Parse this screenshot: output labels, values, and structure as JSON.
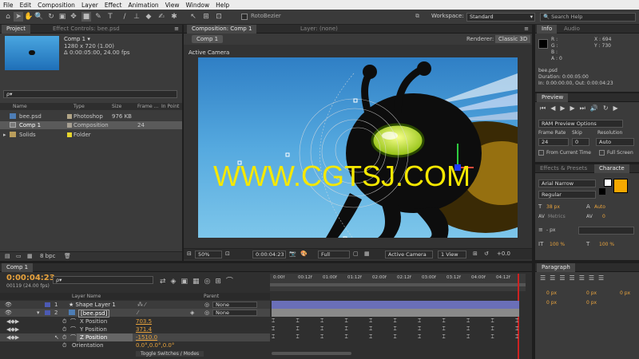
{
  "menu": [
    "File",
    "Edit",
    "Composition",
    "Layer",
    "Effect",
    "Animation",
    "View",
    "Window",
    "Help"
  ],
  "toolbar": {
    "rotobezier": "RotoBezier",
    "workspace_label": "Workspace:",
    "workspace_value": "Standard",
    "search_placeholder": "Search Help"
  },
  "project": {
    "tab": "Project",
    "effect_tab": "Effect Controls: bee.psd",
    "comp_name": "Comp 1 ▾",
    "comp_size": "1280 x 720 (1.00)",
    "comp_duration": "Δ 0:00:05:00, 24.00 fps",
    "search_placeholder": "ρ▾",
    "columns": [
      "Name",
      "Type",
      "Size",
      "Frame ...",
      "In Point"
    ],
    "items": [
      {
        "name": "bee.psd",
        "type": "Photoshop",
        "size": "976 KB",
        "fps": ""
      },
      {
        "name": "Comp 1",
        "type": "Composition",
        "size": "",
        "fps": "24"
      },
      {
        "name": "Solids",
        "type": "Folder",
        "size": "",
        "fps": ""
      }
    ],
    "bpc": "8 bpc"
  },
  "comp": {
    "tab": "Composition: Comp 1",
    "layer_tab": "Layer: (none)",
    "subtab": "Comp 1",
    "renderer_label": "Renderer:",
    "renderer_value": "Classic 3D",
    "active_camera": "Active Camera",
    "watermark": "WWW.CGTSJ.COM",
    "zoom": "50%",
    "timecode": "0:00:04:23",
    "resolution": "Full",
    "camera": "Active Camera",
    "view": "1 View"
  },
  "info": {
    "tab": "Info",
    "audio_tab": "Audio",
    "r": "R :",
    "g": "G :",
    "b": "B :",
    "a": "A : 0",
    "x": "X : 694",
    "y": "Y : 730",
    "file": "bee.psd",
    "duration": "Duration: 0:00:05:00",
    "inout": "In: 0:00:00:00, Out: 0:00:04:23"
  },
  "preview": {
    "tab": "Preview",
    "ram": "RAM Preview Options",
    "frame_rate_label": "Frame Rate",
    "skip_label": "Skip",
    "resolution_label": "Resolution",
    "frame_rate": "24",
    "skip": "0",
    "resolution": "Auto",
    "from_current": "From Current Time",
    "full_screen": "Full Screen"
  },
  "character": {
    "effects_tab": "Effects & Presets",
    "char_tab": "Characte",
    "font": "Arial Narrow",
    "style": "Regular",
    "size": "38 px",
    "leading": "Auto",
    "metrics": "Metrics",
    "tracking": "0",
    "px_label": "- px",
    "scale_v": "100 %",
    "scale_h": "100 %"
  },
  "paragraph": {
    "tab": "Paragraph",
    "px1": "0 px",
    "px2": "0 px",
    "px3": "0 px",
    "px4": "0 px",
    "px5": "0 px"
  },
  "timeline": {
    "tab": "Comp 1",
    "timecode": "0:00:04:23",
    "frames": "00119 (24.00 fps)",
    "search_placeholder": "ρ▾",
    "layer_name_header": "Layer Name",
    "parent_header": "Parent",
    "toggle": "Toggle Switches / Modes",
    "ruler": [
      "0:00f",
      "00:12f",
      "01:00f",
      "01:12f",
      "02:00f",
      "02:12f",
      "03:00f",
      "03:12f",
      "04:00f",
      "04:12f"
    ],
    "layers": [
      {
        "num": "1",
        "name": "★ Shape Layer 1",
        "parent": "None"
      },
      {
        "num": "2",
        "name": "[bee.psd]",
        "parent": "None"
      }
    ],
    "props": [
      {
        "name": "X Position",
        "value": "703.5"
      },
      {
        "name": "Y Position",
        "value": "371.4"
      },
      {
        "name": "Z Position",
        "value": "-1510.0"
      },
      {
        "name": "Orientation",
        "value": "0.0°,0.0°,0.0°"
      }
    ]
  }
}
